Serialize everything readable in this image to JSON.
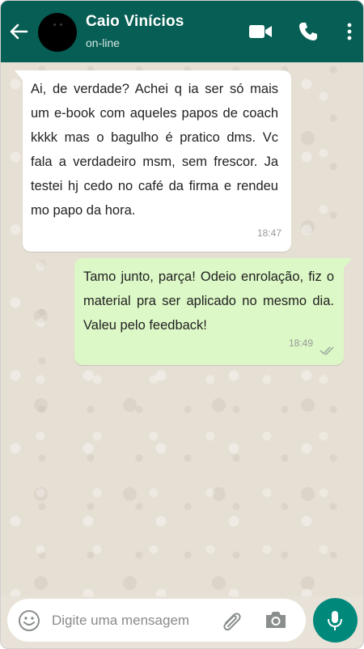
{
  "header": {
    "contact_name": "Caio Vinícios",
    "status": "on-line",
    "background_color": "#075e54",
    "icons": [
      "back-arrow-icon",
      "video-call-icon",
      "phone-icon",
      "more-options-icon"
    ]
  },
  "messages": [
    {
      "direction": "incoming",
      "text": "Ai, de verdade? Achei q ia ser só mais um e-book com aqueles papos de coach kkkk mas o bagulho é pratico dms. Vc fala a verdadeiro msm, sem frescor. Ja testei hj cedo no café da firma e rendeu mo papo da hora.",
      "time": "18:47",
      "bubble_color": "#ffffff"
    },
    {
      "direction": "outgoing",
      "text": "Tamo junto, parça! Odeio enrolação, fiz o material pra ser aplicado no mesmo dia. Valeu pelo feedback!",
      "time": "18:49",
      "status_icon": "double-check-icon",
      "bubble_color": "#dcf8c6"
    }
  ],
  "composer": {
    "placeholder": "Digite uma mensagem",
    "value": "",
    "icons": [
      "emoji-icon",
      "attach-clip-icon",
      "camera-icon",
      "microphone-icon"
    ],
    "mic_button_color": "#00897b"
  }
}
